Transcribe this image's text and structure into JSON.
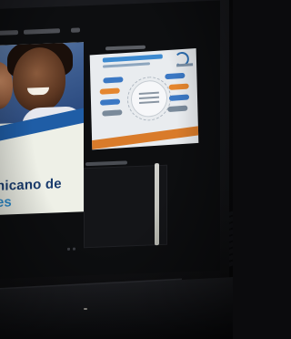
{
  "scene": {
    "description_kind": "photo-of-laptop-screen"
  },
  "slide_left": {
    "line1": "nicano de",
    "line2": "es"
  },
  "colors": {
    "slide_blue": "#1f5da6",
    "slide_light_blue": "#2f8fd0",
    "thumb_orange": "#d97b2a",
    "bezel": "#141518"
  }
}
